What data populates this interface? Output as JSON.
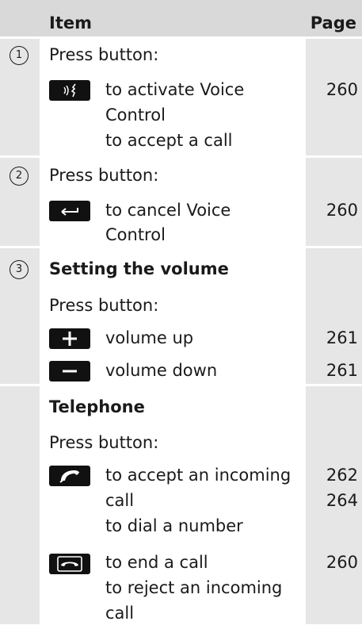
{
  "header": {
    "item": "Item",
    "page": "Page"
  },
  "rows": [
    {
      "marker": "1",
      "intro": "Press button:",
      "icon": "voice-control-icon",
      "lines": [
        "to activate Voice",
        "Control",
        "to accept a call"
      ],
      "page": "260"
    },
    {
      "marker": "2",
      "intro": "Press button:",
      "icon": "back-arrow-icon",
      "lines": [
        "to cancel Voice",
        "Control"
      ],
      "page": "260"
    },
    {
      "marker": "3",
      "title": "Setting the volume",
      "intro": "Press button:",
      "entries": [
        {
          "icon": "plus-icon",
          "text": "volume up",
          "page": "261"
        },
        {
          "icon": "minus-icon",
          "text": "volume down",
          "page": "261"
        }
      ]
    },
    {
      "title": "Telephone",
      "intro": "Press button:",
      "entries": [
        {
          "icon": "phone-accept-icon",
          "lines": [
            "to accept an incoming",
            "call",
            "to dial a number"
          ],
          "pages": [
            "262",
            "264"
          ]
        },
        {
          "icon": "phone-end-icon",
          "lines": [
            "to end a call",
            "to reject an incoming",
            "call"
          ],
          "page": "260"
        }
      ]
    }
  ]
}
